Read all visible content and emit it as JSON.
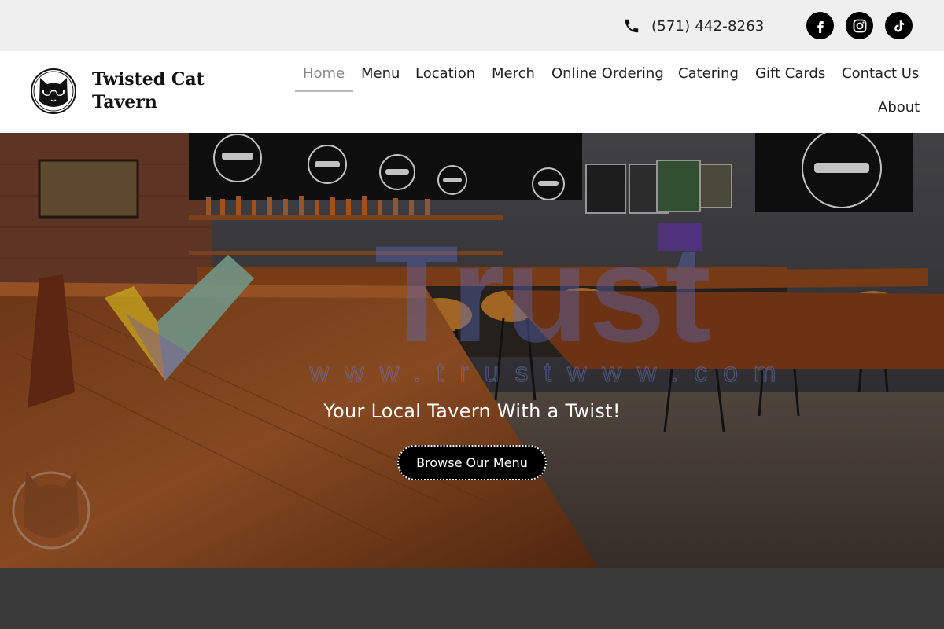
{
  "topbar": {
    "phone": "(571) 442-8263",
    "phone_icon": "phone-icon",
    "social": [
      "facebook-icon",
      "instagram-icon",
      "tiktok-icon"
    ]
  },
  "header": {
    "brand": "Twisted Cat Tavern",
    "logo_icon": "cat-sunglasses-logo",
    "nav": [
      {
        "label": "Home",
        "active": true
      },
      {
        "label": "Menu"
      },
      {
        "label": "Location"
      },
      {
        "label": "Merch"
      },
      {
        "label": "Online Ordering"
      },
      {
        "label": "Catering"
      },
      {
        "label": "Gift Cards"
      },
      {
        "label": "Contact Us"
      },
      {
        "label": "About"
      }
    ]
  },
  "hero": {
    "tagline": "Your Local Tavern With a Twist!",
    "cta_label": "Browse Our Menu",
    "watermark": {
      "word": "Trust",
      "url": "www.trustwww.com"
    }
  },
  "colors": {
    "topbar_bg": "#efefef",
    "accent": "#000000",
    "bottom_bg": "#3a3a3a"
  }
}
